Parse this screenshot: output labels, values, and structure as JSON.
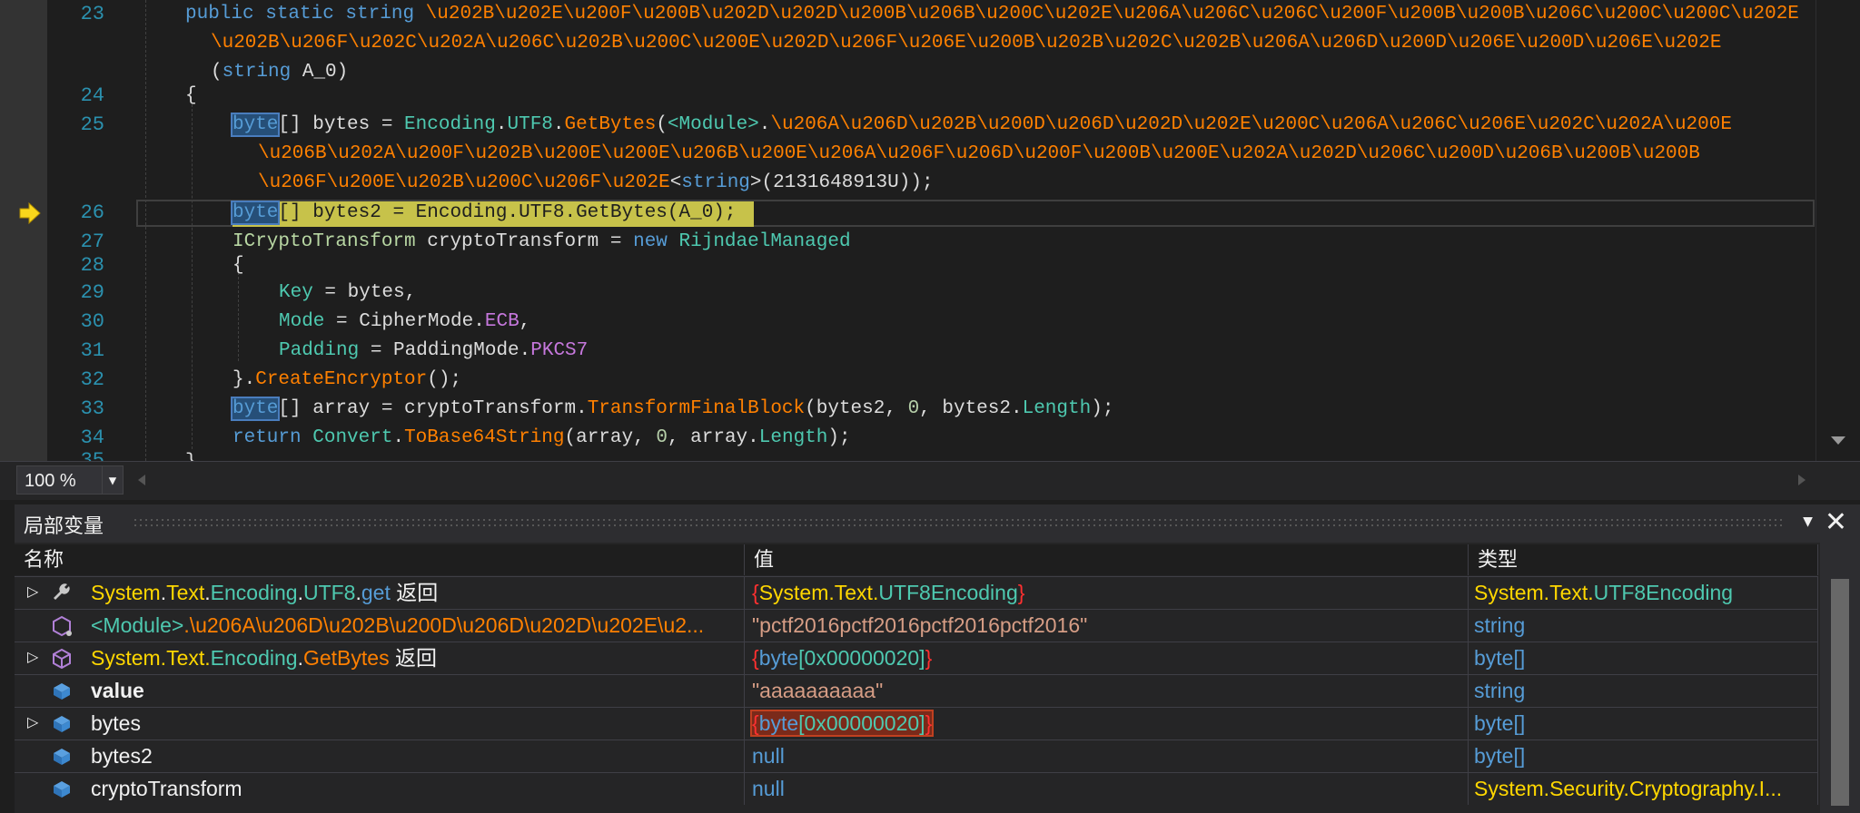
{
  "editor": {
    "lines": [
      {
        "num": "23"
      },
      {
        "num": "24"
      },
      {
        "num": "25"
      },
      {
        "num": "26"
      },
      {
        "num": "27"
      },
      {
        "num": "28"
      },
      {
        "num": "29"
      },
      {
        "num": "30"
      },
      {
        "num": "31"
      },
      {
        "num": "32"
      },
      {
        "num": "33"
      },
      {
        "num": "34"
      },
      {
        "num": "35"
      }
    ],
    "code": {
      "l23a_kw": "public static string",
      "l23a_name": "\\u202B\\u202E\\u200F\\u200B\\u202D\\u202D\\u200B\\u206B\\u200C\\u202E\\u206A\\u206C\\u206C\\u200F\\u200B\\u200B\\u206C\\u200C\\u200C\\u202E",
      "l23b_name": "\\u202B\\u206F\\u202C\\u202A\\u206C\\u202B\\u200C\\u200E\\u202D\\u206F\\u206E\\u200B\\u202B\\u202C\\u202B\\u206A\\u206D\\u200D\\u206E\\u200D\\u206E\\u202E",
      "l23c_open": "(",
      "l23c_kw": "string",
      "l23c_rest": " A_0)",
      "l24": "{",
      "l25_kw": "byte",
      "l25_a": "[] bytes = ",
      "l25_type": "Encoding",
      "l25_dot": ".",
      "l25_prop": "UTF8",
      "l25_dot2": ".",
      "l25_method": "GetBytes",
      "l25_paren": "(",
      "l25_module": "<Module>",
      "l25_dot3": ".",
      "l25_name1": "\\u206A\\u206D\\u202B\\u200D\\u206D\\u202D\\u202E\\u200C\\u206A\\u206C\\u206E\\u202C\\u202A\\u200E",
      "l25b_name": "\\u206B\\u202A\\u200F\\u202B\\u200E\\u200E\\u206B\\u200E\\u206A\\u206F\\u206D\\u200F\\u200B\\u200E\\u202A\\u202D\\u206C\\u200D\\u206B\\u200B\\u200B",
      "l25c_name": "\\u206F\\u200E\\u202B\\u200C\\u206F\\u202E",
      "l25c_lt": "<",
      "l25c_kw": "string",
      "l25c_rest": ">(2131648913U));",
      "l26_kw": "byte",
      "l26_rest": "[] bytes2 = Encoding.UTF8.GetBytes(A_0);",
      "l27_iface": "ICryptoTransform",
      "l27_a": " cryptoTransform = ",
      "l27_new": "new",
      "l27_sp": " ",
      "l27_type": "RijndaelManaged",
      "l28": "{",
      "l29_field": "Key",
      "l29_rest": " = bytes,",
      "l30_field": "Mode",
      "l30_a": " = CipherMode.",
      "l30_member": "ECB",
      "l30_comma": ",",
      "l31_field": "Padding",
      "l31_a": " = PaddingMode.",
      "l31_member": "PKCS7",
      "l32_a": "}.",
      "l32_method": "CreateEncryptor",
      "l32_rest": "();",
      "l33_kw": "byte",
      "l33_a": "[] array = cryptoTransform.",
      "l33_method": "TransformFinalBlock",
      "l33_b": "(bytes2, ",
      "l33_n": "0",
      "l33_c": ", bytes2.",
      "l33_prop": "Length",
      "l33_d": ");",
      "l34_kw": "return",
      "l34_sp": " ",
      "l34_type": "Convert",
      "l34_dot": ".",
      "l34_method": "ToBase64String",
      "l34_a": "(array, ",
      "l34_n": "0",
      "l34_b": ", array.",
      "l34_prop": "Length",
      "l34_c": ");",
      "l35": "}"
    }
  },
  "zoom": {
    "value": "100 %"
  },
  "locals": {
    "title": "局部变量",
    "columns": {
      "name": "名称",
      "value": "值",
      "type": "类型"
    },
    "rows": [
      {
        "name_a": "System",
        "name_b": ".",
        "name_c": "Text",
        "name_d": ".",
        "name_e": "Encoding",
        "name_f": ".",
        "name_g": "UTF8",
        "name_h": ".",
        "name_i": "get",
        "name_j": " 返回",
        "value_a": "{",
        "value_b": "System.Text.",
        "value_c": "UTF8Encoding",
        "value_d": "}",
        "type_a": "System.Text.",
        "type_b": "UTF8Encoding"
      },
      {
        "name_a": "<Module>",
        "name_b": ".\\u206A\\u206D\\u202B\\u200D\\u206D\\u202D\\u202E\\u2...",
        "value": "\"pctf2016pctf2016pctf2016pctf2016\"",
        "type": "string"
      },
      {
        "name_a": "System.Text.",
        "name_b": "Encoding",
        "name_c": ".",
        "name_d": "GetBytes",
        "name_e": " 返回",
        "value_a": "{",
        "value_b": "byte",
        "value_c": "[0x00000020]",
        "value_d": "}",
        "type": "byte[]"
      },
      {
        "name": "value",
        "value": "\"aaaaaaaaaa\"",
        "type": "string"
      },
      {
        "name": "bytes",
        "value_a": "{",
        "value_b": "byte",
        "value_c": "[0x00000020]",
        "value_d": "}",
        "type": "byte[]"
      },
      {
        "name": "bytes2",
        "value": "null",
        "type": "byte[]"
      },
      {
        "name": "cryptoTransform",
        "value": "null",
        "type": "System.Security.Cryptography.I..."
      }
    ]
  },
  "colors": {
    "background": "#1e1e1e",
    "exec_highlight": "#c7c24a",
    "keyword": "#569cd6",
    "type": "#4ec9b0",
    "method": "#ff8000"
  }
}
